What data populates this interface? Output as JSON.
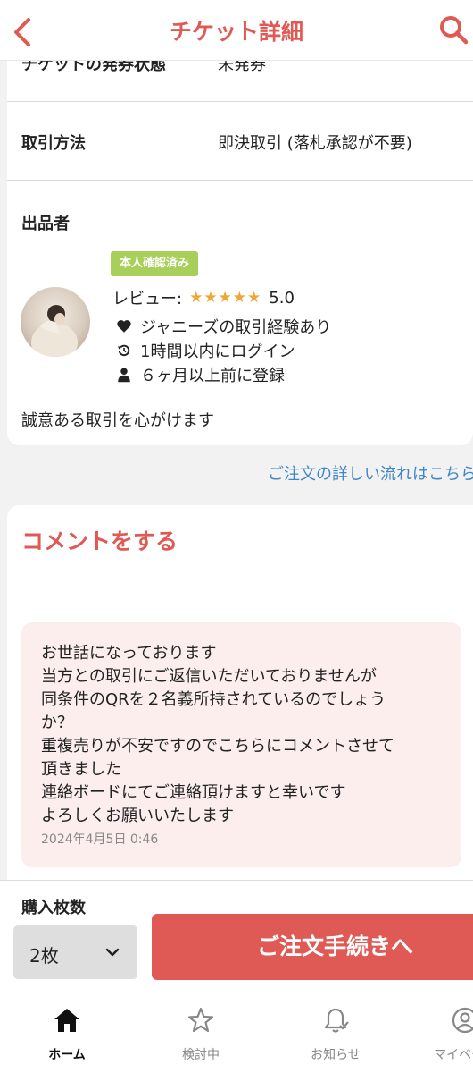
{
  "header": {
    "title": "チケット詳細",
    "back_icon": "chevron-left-icon",
    "search_icon": "search-icon"
  },
  "details": {
    "partial_label": "チケットの発券状態",
    "partial_value": "未発券",
    "method_label": "取引方法",
    "method_value": "即決取引 (落札承認が不要)"
  },
  "seller": {
    "section_label": "出品者",
    "badge": "本人確認済み",
    "review_label": "レビュー:",
    "stars": "★★★★★",
    "rating": "5.0",
    "experience": "ジャニーズの取引経験あり",
    "login": "1時間以内にログイン",
    "registered": "６ヶ月以上前に登録",
    "greeting": "誠意ある取引を心がけます"
  },
  "flow_link": "ご注文の詳しい流れはこちら",
  "comment": {
    "title": "コメントをする",
    "lines": [
      "お世話になっております",
      "当方との取引にご返信いただいておりませんが",
      "同条件のQRを２名義所持されているのでしょう",
      "か？",
      "重複売りが不安ですのでこちらにコメントさせて",
      "頂きました",
      "連絡ボードにてご連絡頂けますと幸いです",
      "よろしくお願いいたします"
    ],
    "timestamp": "2024年4月5日 0:46"
  },
  "purchase": {
    "qty_label": "購入枚数",
    "qty_value": "2枚",
    "order_button": "ご注文手続きへ"
  },
  "tabs": [
    {
      "label": "ホーム",
      "icon": "home-icon",
      "active": true
    },
    {
      "label": "検討中",
      "icon": "star-icon",
      "active": false
    },
    {
      "label": "お知らせ",
      "icon": "bell-icon",
      "active": false
    },
    {
      "label": "マイページ",
      "icon": "user-icon",
      "active": false
    }
  ],
  "colors": {
    "accent": "#e05a55",
    "badge": "#a8cf5a",
    "link": "#3f86c9",
    "stars": "#f0a637"
  }
}
